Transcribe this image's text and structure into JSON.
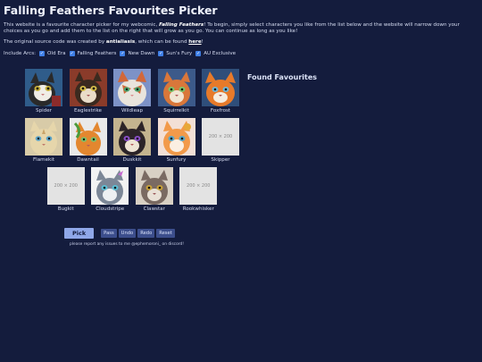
{
  "header": {
    "title": "Falling Feathers Favourites Picker"
  },
  "intro": {
    "part1": "This website is a favourite character picker for my webcomic, ",
    "comic": "Falling Feathers",
    "part2": "! To begin, simply select characters you like from the list below and the website will narrow down your choices as you go and add them to the list on the right that will grow as you go. You can continue as long as you like!"
  },
  "source": {
    "part1": "The original source code was created by ",
    "author": "antialiasis",
    "part2": ", which can be found ",
    "link": "here",
    "part3": "!"
  },
  "arcs": {
    "label": "Include Arcs:",
    "items": [
      {
        "label": "Old Era",
        "checked": true
      },
      {
        "label": "Falling Feathers",
        "checked": true
      },
      {
        "label": "New Dawn",
        "checked": true
      },
      {
        "label": "Sun's Fury",
        "checked": true
      },
      {
        "label": "AU Exclusive",
        "checked": true
      }
    ]
  },
  "characters": {
    "row1": [
      {
        "name": "Spider"
      },
      {
        "name": "Eaglestrike"
      },
      {
        "name": "Wildleap"
      },
      {
        "name": "Squirrelkit"
      },
      {
        "name": "Foxfrost"
      }
    ],
    "row2": [
      {
        "name": "Flamekit"
      },
      {
        "name": "Dawntail"
      },
      {
        "name": "Duskkit"
      },
      {
        "name": "Sunfury"
      },
      {
        "name": "Skipper",
        "placeholder": "200 × 200"
      }
    ],
    "row3": [
      {
        "name": "Bugkit",
        "placeholder": "200 × 200"
      },
      {
        "name": "Cloudstripe"
      },
      {
        "name": "Clawstar"
      },
      {
        "name": "Rookwhisker",
        "placeholder": "200 × 200"
      }
    ]
  },
  "results": {
    "title": "Found Favourites"
  },
  "controls": {
    "pick": "Pick",
    "pass": "Pass",
    "undo": "Undo",
    "redo": "Redo",
    "reset": "Reset"
  },
  "footer": {
    "text": "please report any issues to me @ephemoroni_ on discord!"
  },
  "colors": {
    "background": "#141c3d",
    "button": "#3c4e8c",
    "pick_button": "#8fa7e8",
    "checkbox": "#3f7fe6"
  }
}
